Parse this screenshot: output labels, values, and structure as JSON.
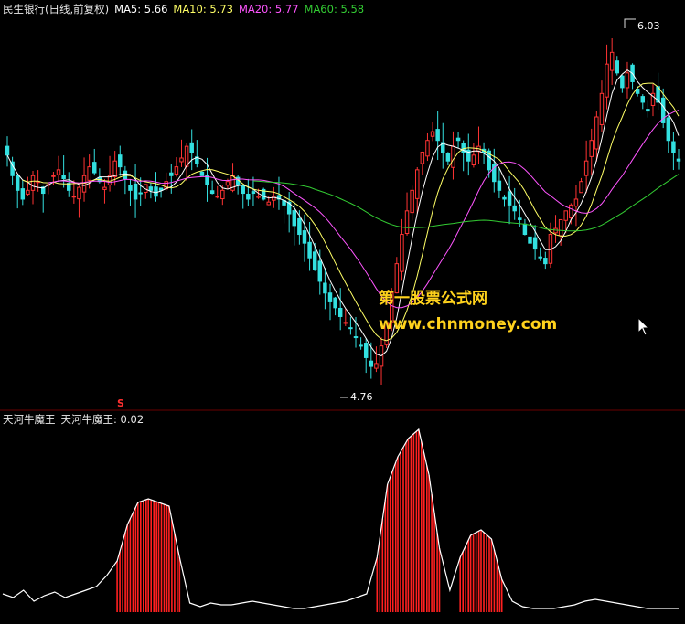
{
  "header": {
    "title": "民生银行(日线,前复权)",
    "ma5_label": "MA5: 5.66",
    "ma10_label": "MA10: 5.73",
    "ma20_label": "MA20: 5.77",
    "ma60_label": "MA60: 5.58",
    "colors": {
      "title": "#e8e8e8",
      "ma5": "#ffffff",
      "ma10": "#ffff66",
      "ma20": "#ff55ff",
      "ma60": "#33cc33"
    }
  },
  "indicator": {
    "name": "天河牛魔王",
    "value_label": "天河牛魔王: 0.02",
    "signal_mark": "S"
  },
  "annotations": {
    "high_label": "6.03",
    "low_label": "4.76"
  },
  "watermark": {
    "line1": "第一股票公式网",
    "line2": "www.chnmoney.com",
    "color": "#ffd21c"
  },
  "colors": {
    "up": "#ff3333",
    "down": "#33e0e0",
    "background": "#000000",
    "indicator_line": "#ffffff",
    "indicator_bar": "#ff2020"
  },
  "chart_data": [
    {
      "type": "candlestick",
      "title": "民生银行(日线,前复权)",
      "high": 6.03,
      "low": 4.76,
      "series": [
        {
          "name": "MA5",
          "value": 5.66
        },
        {
          "name": "MA10",
          "value": 5.73
        },
        {
          "name": "MA20",
          "value": 5.77
        },
        {
          "name": "MA60",
          "value": 5.58
        }
      ],
      "close": [
        5.57,
        5.5,
        5.45,
        5.42,
        5.45,
        5.5,
        5.48,
        5.44,
        5.47,
        5.5,
        5.52,
        5.49,
        5.45,
        5.43,
        5.46,
        5.5,
        5.53,
        5.51,
        5.48,
        5.46,
        5.5,
        5.55,
        5.53,
        5.49,
        5.45,
        5.42,
        5.44,
        5.47,
        5.45,
        5.43,
        5.45,
        5.48,
        5.5,
        5.53,
        5.56,
        5.6,
        5.58,
        5.54,
        5.5,
        5.47,
        5.44,
        5.43,
        5.45,
        5.48,
        5.5,
        5.47,
        5.44,
        5.42,
        5.44,
        5.43,
        5.42,
        5.41,
        5.43,
        5.42,
        5.4,
        5.37,
        5.33,
        5.3,
        5.27,
        5.22,
        5.18,
        5.14,
        5.1,
        5.07,
        5.05,
        5.02,
        5.0,
        4.98,
        4.95,
        4.92,
        4.88,
        4.85,
        4.86,
        4.92,
        5.0,
        5.1,
        5.2,
        5.3,
        5.38,
        5.45,
        5.52,
        5.58,
        5.62,
        5.65,
        5.62,
        5.58,
        5.55,
        5.6,
        5.62,
        5.58,
        5.55,
        5.57,
        5.6,
        5.58,
        5.52,
        5.48,
        5.45,
        5.42,
        5.4,
        5.38,
        5.35,
        5.3,
        5.27,
        5.25,
        5.22,
        5.2,
        5.3,
        5.32,
        5.35,
        5.38,
        5.4,
        5.42,
        5.48,
        5.55,
        5.62,
        5.7,
        5.78,
        5.88,
        5.92,
        5.85,
        5.8,
        5.85,
        5.82,
        5.78,
        5.75,
        5.72,
        5.78,
        5.75,
        5.68,
        5.62,
        5.58,
        5.55
      ]
    },
    {
      "type": "bar",
      "title": "天河牛魔王",
      "current_value": 0.02,
      "values": [
        0.1,
        0.08,
        0.12,
        0.06,
        0.09,
        0.11,
        0.08,
        0.1,
        0.12,
        0.14,
        0.2,
        0.28,
        0.48,
        0.6,
        0.62,
        0.6,
        0.58,
        0.3,
        0.05,
        0.03,
        0.05,
        0.04,
        0.04,
        0.05,
        0.06,
        0.05,
        0.04,
        0.03,
        0.02,
        0.02,
        0.03,
        0.04,
        0.05,
        0.06,
        0.08,
        0.1,
        0.3,
        0.7,
        0.85,
        0.95,
        1.0,
        0.75,
        0.35,
        0.12,
        0.3,
        0.42,
        0.45,
        0.4,
        0.18,
        0.06,
        0.03,
        0.02,
        0.02,
        0.02,
        0.03,
        0.04,
        0.06,
        0.07,
        0.06,
        0.05,
        0.04,
        0.03,
        0.02,
        0.02,
        0.02,
        0.02
      ],
      "bar_ranges": [
        [
          11,
          17
        ],
        [
          36,
          42
        ],
        [
          44,
          48
        ]
      ]
    }
  ]
}
